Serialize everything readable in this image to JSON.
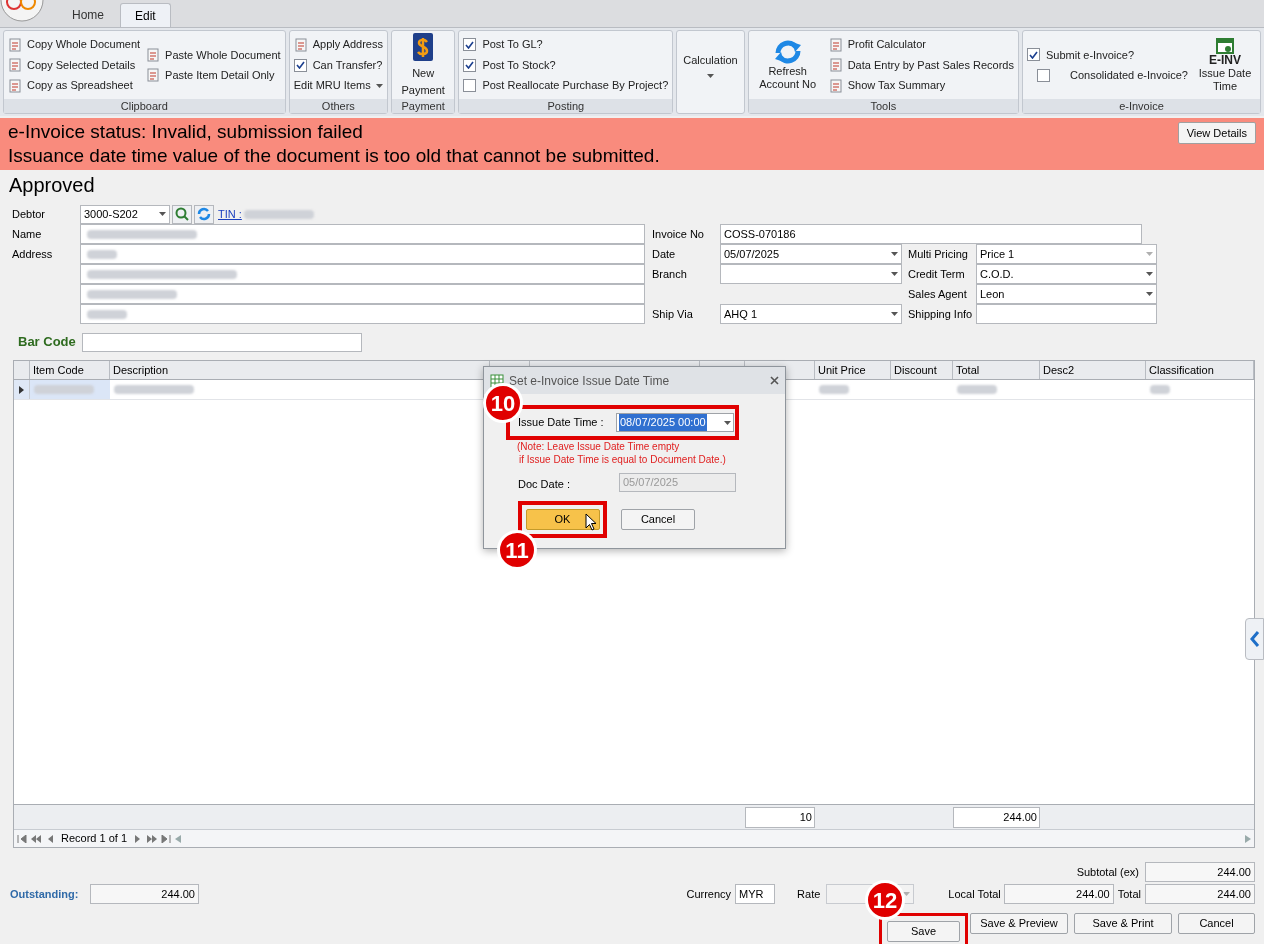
{
  "app_tabs": [
    {
      "label": "Home",
      "selected": false
    },
    {
      "label": "Edit",
      "selected": true
    }
  ],
  "ribbon": {
    "groups": [
      {
        "title": "Clipboard",
        "columns": [
          [
            {
              "kind": "small",
              "label": "Copy Whole Document"
            },
            {
              "kind": "small",
              "label": "Copy Selected Details"
            },
            {
              "kind": "small",
              "label": "Copy as Spreadsheet"
            }
          ],
          [
            {
              "kind": "small",
              "label": "Paste Whole Document"
            },
            {
              "kind": "small",
              "label": "Paste Item Detail Only"
            }
          ]
        ]
      },
      {
        "title": "Others",
        "columns": [
          [
            {
              "kind": "small",
              "label": "Apply Address"
            },
            {
              "kind": "check",
              "label": "Can Transfer?",
              "checked": true
            },
            {
              "kind": "dropdown",
              "label": "Edit MRU Items"
            }
          ]
        ]
      },
      {
        "title": "Payment",
        "columns": [
          [
            {
              "kind": "payment",
              "label": "New Payment"
            }
          ]
        ]
      },
      {
        "title": "Posting",
        "columns": [
          [
            {
              "kind": "check",
              "label": "Post To GL?",
              "checked": true
            },
            {
              "kind": "check",
              "label": "Post To Stock?",
              "checked": true
            },
            {
              "kind": "check",
              "label": "Post Reallocate Purchase By Project?",
              "checked": false
            }
          ]
        ]
      },
      {
        "columns": [
          [
            {
              "kind": "calc",
              "label": "Calculation"
            }
          ]
        ]
      },
      {
        "title": "Tools",
        "columns": [
          [
            {
              "kind": "refresh",
              "label": "Refresh Account No"
            }
          ],
          [
            {
              "kind": "small",
              "label": "Profit Calculator"
            },
            {
              "kind": "small",
              "label": "Data Entry by Past Sales Records"
            },
            {
              "kind": "small",
              "label": "Show Tax Summary"
            }
          ]
        ]
      },
      {
        "title": "e-Invoice",
        "columns": [
          [
            {
              "kind": "check",
              "label": "Submit e-Invoice?",
              "checked": true
            },
            {
              "kind": "check",
              "label": "Consolidated e-Invoice?",
              "checked": false
            }
          ],
          [
            {
              "kind": "einv",
              "label": "Issue Date Time",
              "badge": "E-INV"
            }
          ]
        ]
      }
    ]
  },
  "einvoice_status": {
    "lines": [
      "e-Invoice status: Invalid, submission failed",
      "Issuance date time value of the document is too old that cannot be submitted."
    ],
    "button": "View Details"
  },
  "doc_status": "Approved",
  "debtor": {
    "label": "Debtor",
    "value": "3000-S202",
    "tin_link": "TIN :"
  },
  "name_label": "Name",
  "address_label": "Address",
  "middle_fields": [
    {
      "label": "Invoice No",
      "value": "COSS-070186",
      "kind": "text"
    },
    {
      "label": "Date",
      "value": "05/07/2025",
      "kind": "combo",
      "disabled": false
    },
    {
      "label": "Branch",
      "kind": "combo",
      "disabled": false
    },
    {
      "label": "Ship Via",
      "value": "AHQ 1",
      "kind": "combo",
      "disabled": false
    }
  ],
  "right_fields": [
    {
      "label": "Multi Pricing",
      "value": "Price 1",
      "kind": "combo",
      "disabled": true
    },
    {
      "label": "Credit Term",
      "value": "C.O.D.",
      "kind": "combo",
      "disabled": false
    },
    {
      "label": "Sales Agent",
      "value": "Leon",
      "kind": "combo",
      "disabled": false
    },
    {
      "label": "Shipping Info",
      "kind": "text"
    }
  ],
  "bar_code": {
    "label": "Bar Code"
  },
  "table": {
    "columns": [
      "Item Code",
      "Description",
      "Unit Price",
      "Discount",
      "Total",
      "Desc2",
      "Classification"
    ],
    "rows": [
      {
        "selected": true
      }
    ],
    "footer_totals": [
      "10",
      "244.00"
    ],
    "navigator": "Record 1 of 1"
  },
  "outstanding": {
    "label": "Outstanding:",
    "value": "244.00"
  },
  "currency": {
    "label": "Currency",
    "value": "MYR"
  },
  "rate": {
    "label": "Rate"
  },
  "subtotal": {
    "label": "Subtotal (ex)",
    "value": "244.00"
  },
  "local_total": {
    "label": "Local Total",
    "value": "244.00"
  },
  "total": {
    "label": "Total",
    "value": "244.00"
  },
  "buttons": [
    "Save",
    "Save & Preview",
    "Save & Print",
    "Cancel"
  ],
  "dialog": {
    "title": "Set e-Invoice Issue Date Time",
    "issue_label": "Issue Date Time :",
    "issue_value": "08/07/2025 00:00",
    "note_lines": [
      "(Note: Leave Issue Date Time empty",
      "if Issue Date Time is equal to Document Date.)"
    ],
    "doc_date_label": "Doc Date :",
    "doc_date_value": "05/07/2025",
    "ok": "OK",
    "cancel": "Cancel"
  },
  "annotations": [
    "10",
    "11",
    "12"
  ]
}
